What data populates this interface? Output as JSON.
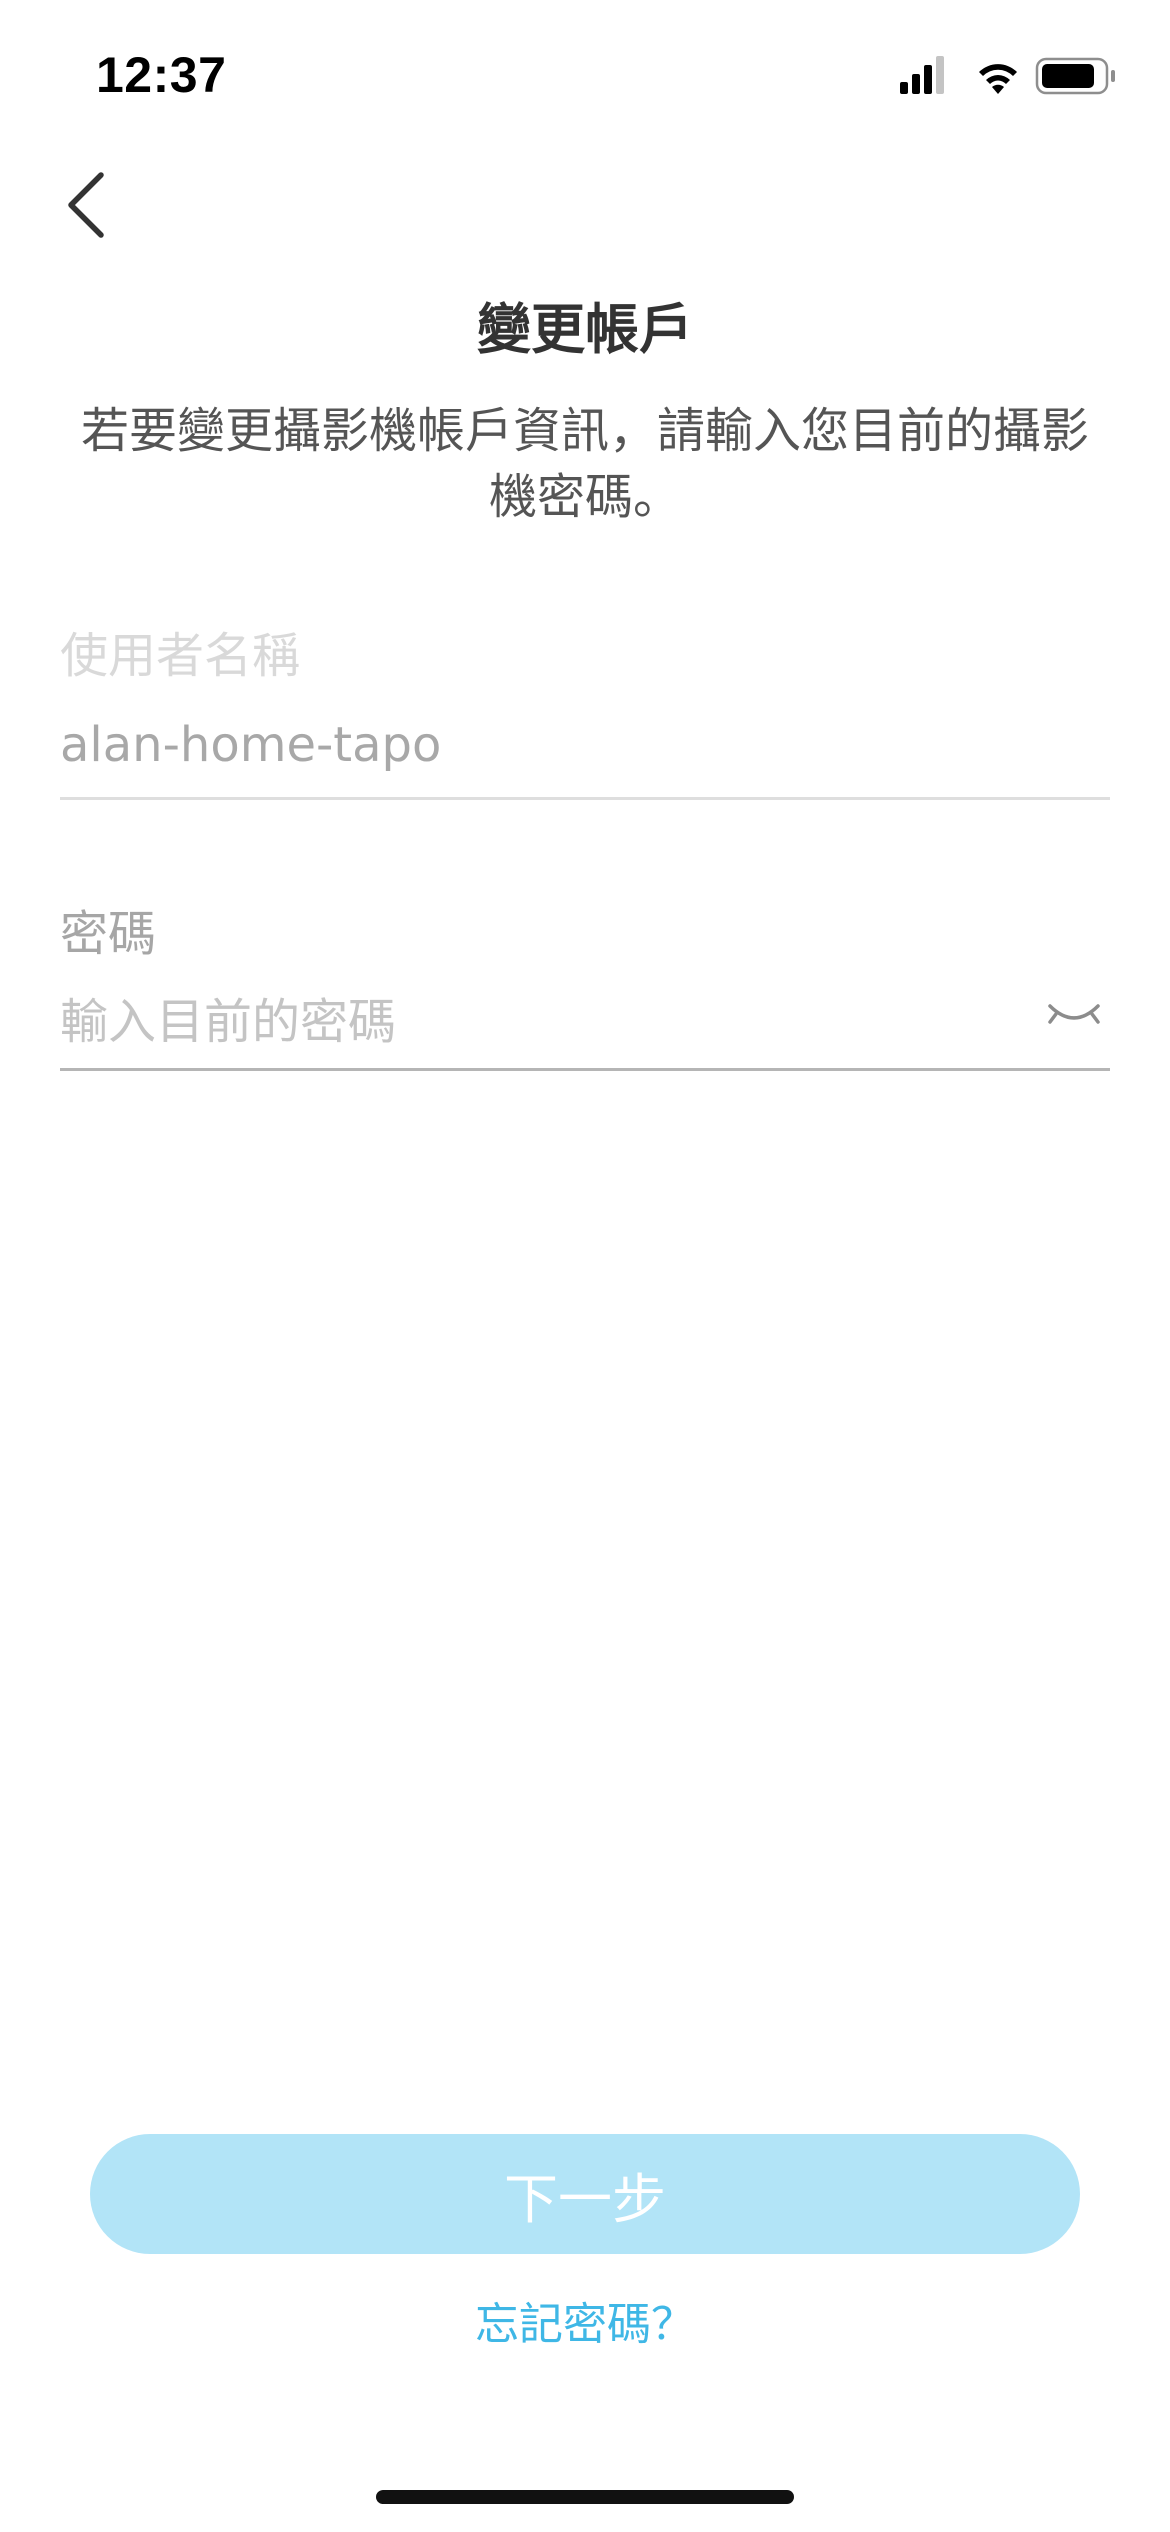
{
  "status_bar": {
    "time": "12:37"
  },
  "header": {
    "title": "變更帳戶",
    "description": "若要變更攝影機帳戶資訊，請輸入您目前的攝影機密碼。"
  },
  "form": {
    "username": {
      "label": "使用者名稱",
      "value": "alan-home-tapo"
    },
    "password": {
      "label": "密碼",
      "placeholder": "輸入目前的密碼"
    }
  },
  "actions": {
    "next_label": "下一步",
    "forgot_label": "忘記密碼？"
  },
  "colors": {
    "accent": "#3fb7e6",
    "button_disabled": "#b2e4f7"
  },
  "icons": {
    "back": "chevron-left-icon",
    "visibility": "eye-closed-icon",
    "signal": "cellular-signal-icon",
    "wifi": "wifi-icon",
    "battery": "battery-icon"
  }
}
